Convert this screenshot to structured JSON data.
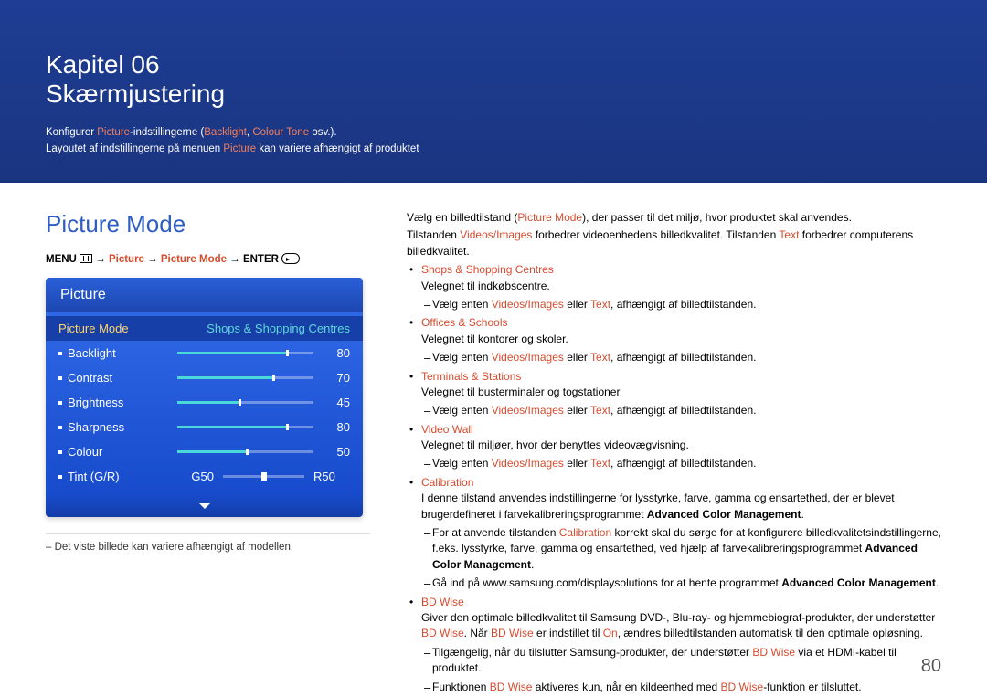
{
  "chapter": {
    "line1": "Kapitel 06",
    "line2": "Skærmjustering"
  },
  "intro": {
    "t1": "Konfigurer ",
    "t2": "Picture",
    "t3": "-indstillingerne (",
    "t4": "Backlight",
    "t5": ", ",
    "t6": "Colour Tone",
    "t7": " osv.).",
    "l2a": "Layoutet af indstillingerne på menuen ",
    "l2b": "Picture",
    "l2c": " kan variere afhængigt af produktet"
  },
  "pictureMode": {
    "heading": "Picture Mode",
    "path": {
      "menu": "MENU ",
      "arrow": " → ",
      "p1": "Picture",
      "p2": "Picture Mode",
      "enter": "ENTER "
    },
    "osd": {
      "title": "Picture",
      "modeLabel": "Picture Mode",
      "modeValue": "Shops & Shopping Centres",
      "rows": [
        {
          "label": "Backlight",
          "value": 80
        },
        {
          "label": "Contrast",
          "value": 70
        },
        {
          "label": "Brightness",
          "value": 45
        },
        {
          "label": "Sharpness",
          "value": 80
        },
        {
          "label": "Colour",
          "value": 50
        }
      ],
      "tint": {
        "label": "Tint (G/R)",
        "g": "G50",
        "r": "R50"
      }
    },
    "note": "Det viste billede kan variere afhængigt af modellen."
  },
  "body": {
    "lead1a": "Vælg en billedtilstand (",
    "lead1b": "Picture Mode",
    "lead1c": "), der passer til det miljø, hvor produktet skal anvendes.",
    "lead2a": "Tilstanden ",
    "lead2b": "Videos/Images",
    "lead2c": " forbedrer videoenhedens billedkvalitet. Tilstanden ",
    "lead2d": "Text",
    "lead2e": " forbedrer computerens billedkvalitet.",
    "items": [
      {
        "title": "Shops & Shopping Centres",
        "desc": "Velegnet til indkøbscentre.",
        "sub": {
          "a": "Vælg enten ",
          "b": "Videos/Images",
          "c": " eller ",
          "d": "Text",
          "e": ", afhængigt af billedtilstanden."
        }
      },
      {
        "title": "Offices & Schools",
        "desc": "Velegnet til kontorer og skoler.",
        "sub": {
          "a": "Vælg enten ",
          "b": "Videos/Images",
          "c": " eller ",
          "d": "Text",
          "e": ", afhængigt af billedtilstanden."
        }
      },
      {
        "title": "Terminals & Stations",
        "desc": "Velegnet til busterminaler og togstationer.",
        "sub": {
          "a": "Vælg enten ",
          "b": "Videos/Images",
          "c": " eller ",
          "d": "Text",
          "e": ", afhængigt af billedtilstanden."
        }
      },
      {
        "title": "Video Wall",
        "desc": "Velegnet til miljøer, hvor der benyttes videovægvisning.",
        "sub": {
          "a": "Vælg enten ",
          "b": "Videos/Images",
          "c": " eller ",
          "d": "Text",
          "e": ", afhængigt af billedtilstanden."
        }
      }
    ],
    "calibration": {
      "title": "Calibration",
      "desc": "I denne tilstand anvendes indstillingerne for lysstyrke, farve, gamma og ensartethed, der er blevet brugerdefineret i farvekalibreringsprogrammet ",
      "prog": "Advanced Color Management",
      "dot": ".",
      "s1a": "For at anvende tilstanden ",
      "s1b": "Calibration",
      "s1c": " korrekt skal du sørge for at konfigurere billedkvalitetsindstillingerne, f.eks. lysstyrke, farve, gamma og ensartethed, ved hjælp af farvekalibreringsprogrammet ",
      "s1d": "Advanced Color Management",
      "s1e": ".",
      "s2a": "Gå ind på www.samsung.com/displaysolutions for at hente programmet ",
      "s2b": "Advanced Color Management",
      "s2c": "."
    },
    "bdwise": {
      "title": "BD Wise",
      "desc1a": "Giver den optimale billedkvalitet til Samsung DVD-, Blu-ray- og hjemmebiograf-produkter, der understøtter ",
      "desc1b": "BD Wise",
      "desc1c": ". Når ",
      "desc1d": "BD Wise",
      "desc1e": " er indstillet til ",
      "desc1f": "On",
      "desc1g": ", ændres billedtilstanden automatisk til den optimale opløsning.",
      "s1a": "Tilgængelig, når du tilslutter Samsung-produkter, der understøtter ",
      "s1b": "BD Wise",
      "s1c": " via et HDMI-kabel til produktet.",
      "s2a": "Funktionen ",
      "s2b": "BD Wise",
      "s2c": " aktiveres kun, når en kildeenhed med ",
      "s2d": "BD Wise",
      "s2e": "-funktion er tilsluttet."
    }
  },
  "pageNumber": "80"
}
